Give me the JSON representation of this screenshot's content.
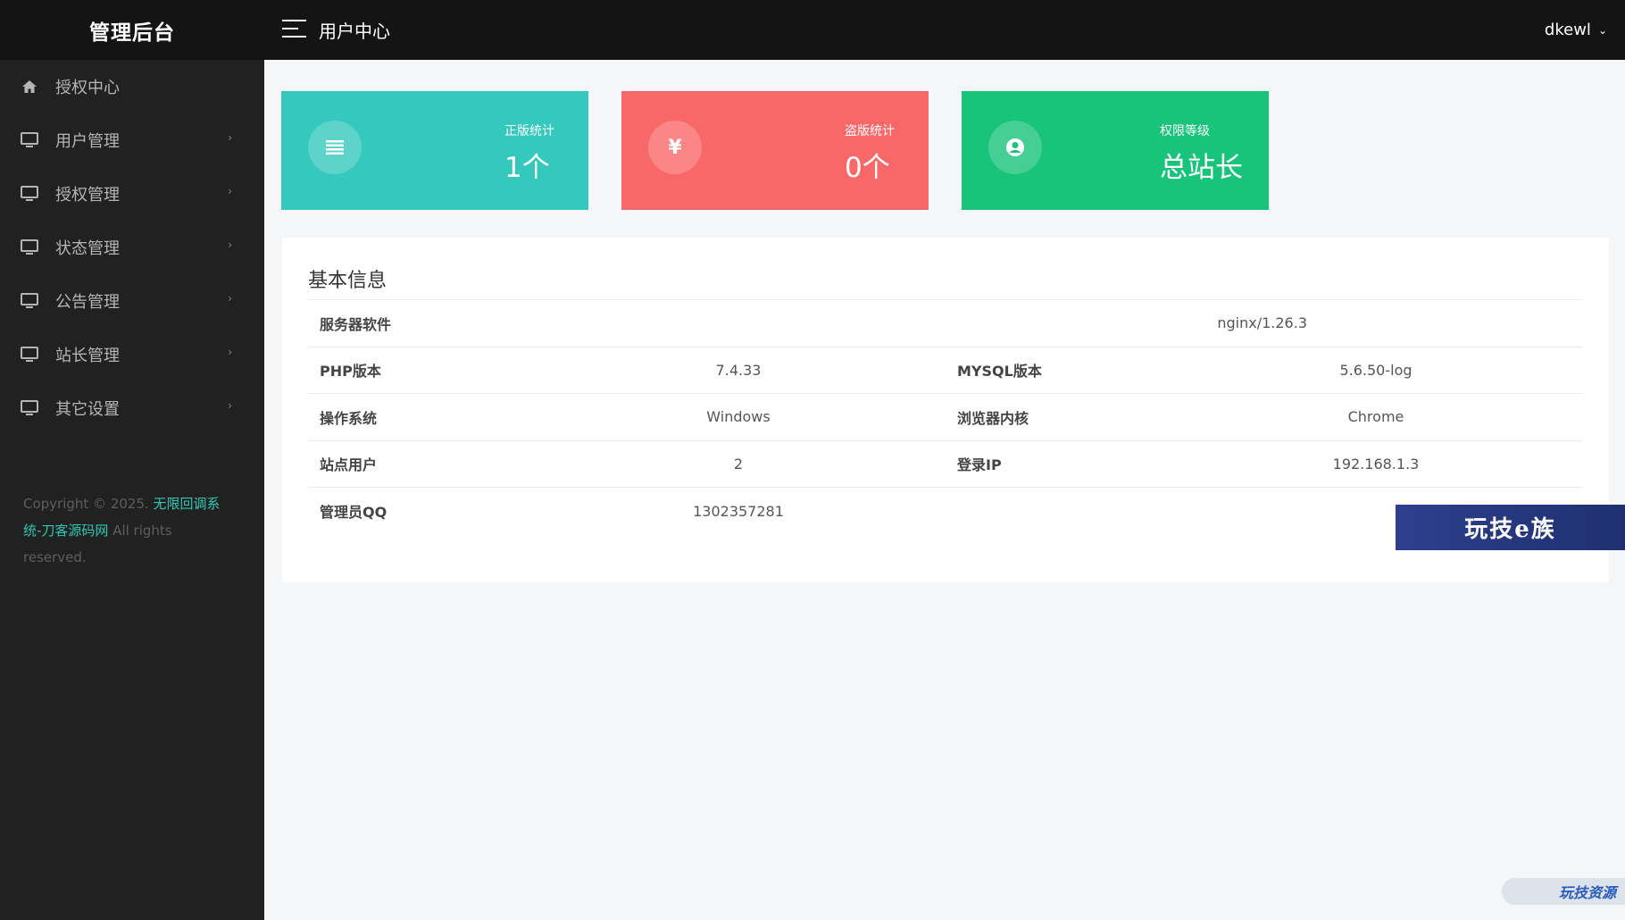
{
  "header": {
    "brand": "管理后台",
    "breadcrumb": "用户中心",
    "username": "dkewl"
  },
  "sidebar": {
    "items": [
      {
        "label": "授权中心",
        "icon": "home-icon"
      },
      {
        "label": "用户管理",
        "icon": "monitor-icon"
      },
      {
        "label": "授权管理",
        "icon": "monitor-icon"
      },
      {
        "label": "状态管理",
        "icon": "monitor-icon"
      },
      {
        "label": "公告管理",
        "icon": "monitor-icon"
      },
      {
        "label": "站长管理",
        "icon": "monitor-icon"
      },
      {
        "label": "其它设置",
        "icon": "monitor-icon"
      }
    ],
    "copyright_prefix": "Copyright © 2025. ",
    "copyright_link": "无限回调系统-刀客源码网",
    "copyright_suffix": " All rights reserved."
  },
  "stats": [
    {
      "label": "正版统计",
      "value": "1个",
      "icon": "list-icon",
      "color": "#35c9bd"
    },
    {
      "label": "盗版统计",
      "value": "0个",
      "icon": "yen-icon",
      "color": "#f96868"
    },
    {
      "label": "权限等级",
      "value": "总站长",
      "icon": "user-circle-icon",
      "color": "#18c37a"
    }
  ],
  "info": {
    "title": "基本信息",
    "rows": [
      {
        "k1": "服务器软件",
        "v1": "nginx/1.26.3"
      },
      {
        "k1": "PHP版本",
        "v1": "7.4.33",
        "k2": "MYSQL版本",
        "v2": "5.6.50-log"
      },
      {
        "k1": "操作系统",
        "v1": "Windows",
        "k2": "浏览器内核",
        "v2": "Chrome"
      },
      {
        "k1": "站点用户",
        "v1": "2",
        "k2": "登录IP",
        "v2": "192.168.1.3"
      },
      {
        "k1": "管理员QQ",
        "v1": "1302357281"
      }
    ]
  },
  "watermark": "玩技e族",
  "corner_badge": "玩技资源"
}
